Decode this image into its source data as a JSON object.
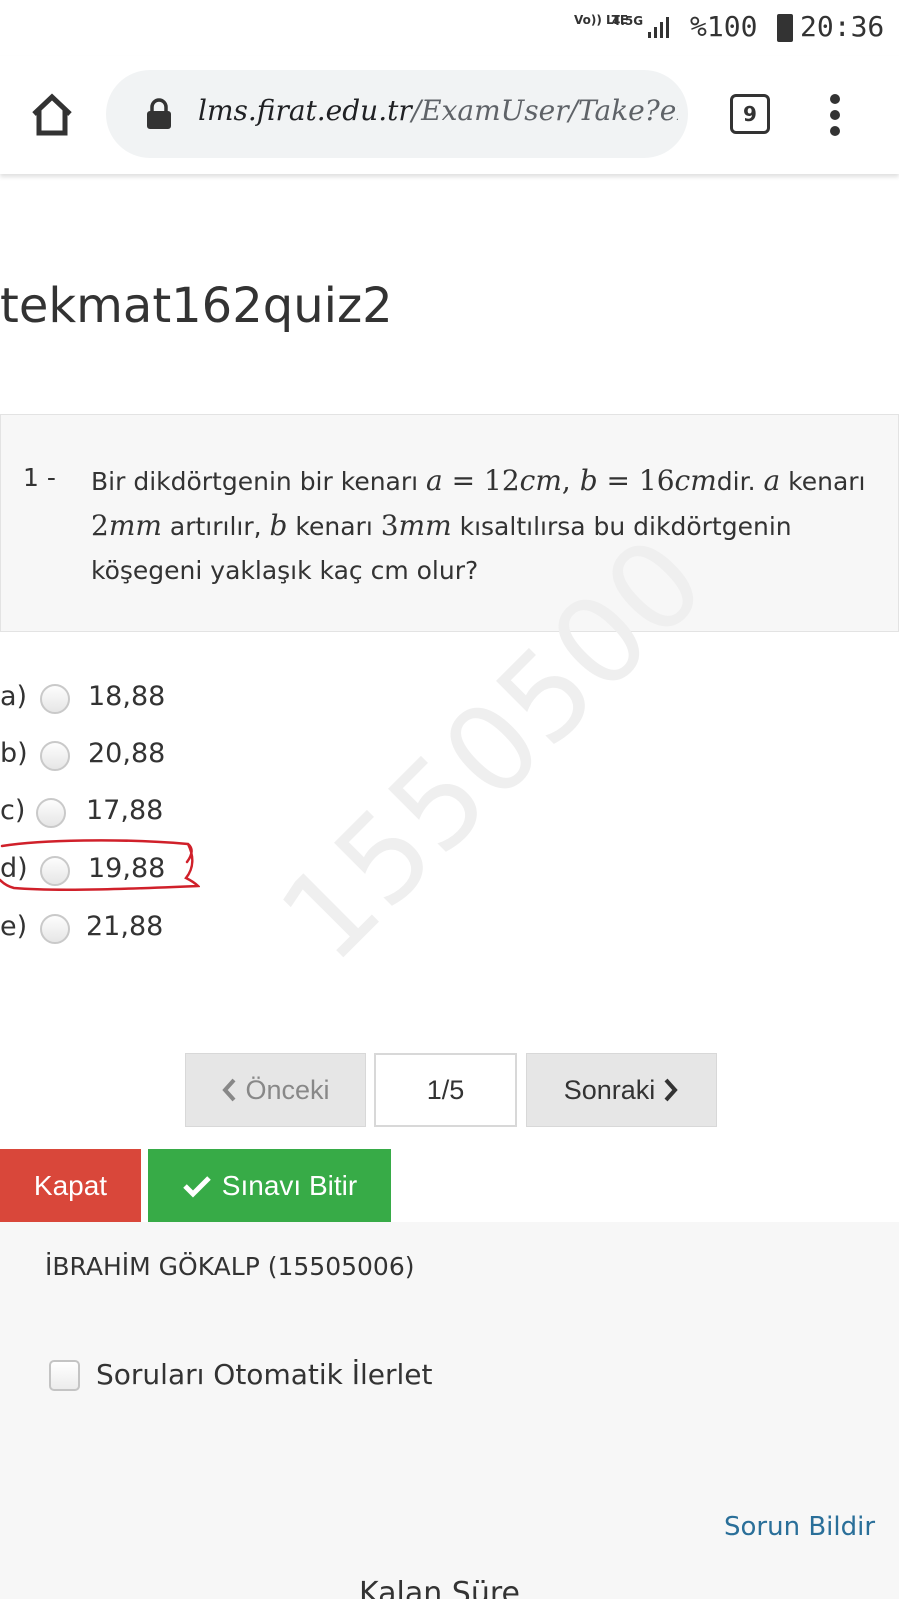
{
  "status_bar": {
    "volte": "Vo)) LTE",
    "network": "4.5G",
    "battery": "%100",
    "time": "20:36"
  },
  "browser": {
    "url_main": "lms.firat.edu.tr",
    "url_path": "/ExamUser/Take?exc",
    "tab_count": "9"
  },
  "exam": {
    "title": "tekmat162quiz2",
    "question_number": "1 -",
    "question": {
      "t1": "Bir dikdörtgenin bir kenarı ",
      "m1": "a",
      "m2": " = ",
      "m3": "12",
      "m4": "cm",
      "m5": ", ",
      "m6": "b",
      "m7": " = ",
      "m8": "16",
      "m9": "cm",
      "t2": "dir. ",
      "m10": "a",
      "t3": " kenarı ",
      "m11": "2",
      "m12": "mm",
      "t4": " artırılır, ",
      "m13": "b",
      "t5": " kenarı ",
      "m14": "3",
      "m15": "mm",
      "t6": " kısaltılırsa bu dikdörtgenin köşegeni yaklaşık kaç cm olur?"
    },
    "watermark": "1550500",
    "options": [
      {
        "letter": "a)",
        "value": "18,88"
      },
      {
        "letter": "b)",
        "value": "20,88"
      },
      {
        "letter": "c)",
        "value": "17,88"
      },
      {
        "letter": "d)",
        "value": "19,88"
      },
      {
        "letter": "e)",
        "value": "21,88"
      }
    ],
    "pager": {
      "prev_label": "Önceki",
      "indicator": "1/5",
      "next_label": "Sonraki"
    },
    "close_label": "Kapat",
    "finish_label": "Sınavı Bitir",
    "student": "İBRAHİM GÖKALP (15505006)",
    "auto_advance_label": "Soruları Otomatik İlerlet",
    "report_label": "Sorun Bildir",
    "remaining_label": "Kalan Süre"
  },
  "colors": {
    "close": "#d9473a",
    "finish": "#37ab47",
    "link": "#2a6f99",
    "annotation": "#d0202a"
  }
}
